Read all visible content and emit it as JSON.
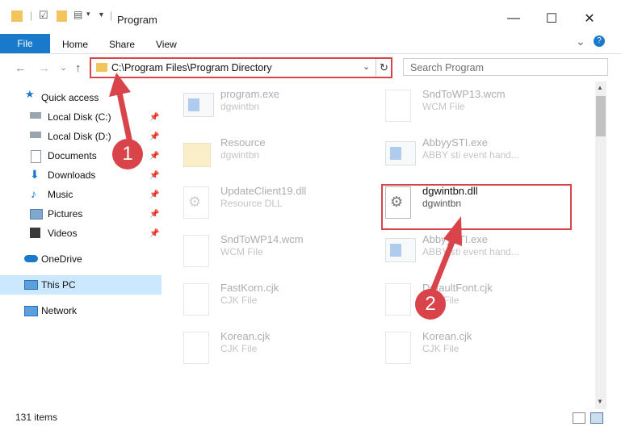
{
  "window": {
    "title": "Program",
    "minimize_glyph": "—",
    "maximize_glyph": "☐",
    "close_glyph": "✕"
  },
  "ribbon": {
    "tabs": [
      "File",
      "Home",
      "Share",
      "View"
    ],
    "collapse_glyph": "⌄",
    "help_glyph": "?"
  },
  "address": {
    "path": "C:\\Program Files\\Program Directory",
    "dropdown_glyph": "⌄",
    "refresh_glyph": "↻"
  },
  "search": {
    "placeholder": "Search Program"
  },
  "nav": {
    "back_glyph": "←",
    "forward_glyph": "→",
    "history_glyph": "⌄",
    "up_glyph": "↑",
    "items": [
      {
        "label": "Quick access",
        "icon": "star-icon",
        "pinned": false
      },
      {
        "label": "Local Disk (C:)",
        "icon": "drive-icon",
        "pinned": true
      },
      {
        "label": "Local Disk (D:)",
        "icon": "drive-icon",
        "pinned": true
      },
      {
        "label": "Documents",
        "icon": "documents-icon",
        "pinned": true
      },
      {
        "label": "Downloads",
        "icon": "download-icon",
        "pinned": true
      },
      {
        "label": "Music",
        "icon": "music-icon",
        "pinned": true
      },
      {
        "label": "Pictures",
        "icon": "pictures-icon",
        "pinned": true
      },
      {
        "label": "Videos",
        "icon": "videos-icon",
        "pinned": true
      },
      {
        "label": "OneDrive",
        "icon": "cloud-icon",
        "pinned": false
      },
      {
        "label": "This PC",
        "icon": "computer-icon",
        "pinned": false,
        "selected": true
      },
      {
        "label": "Network",
        "icon": "network-icon",
        "pinned": false
      }
    ]
  },
  "files": [
    {
      "name": "program.exe",
      "sub": "dgwintbn",
      "icon": "exe-icon"
    },
    {
      "name": "SndToWP13.wcm",
      "sub": "WCM File",
      "icon": "file-icon"
    },
    {
      "name": "Resource",
      "sub": "dgwintbn",
      "icon": "folder-icon"
    },
    {
      "name": "AbbyySTI.exe",
      "sub": "ABBY sti event hand...",
      "icon": "exe-icon"
    },
    {
      "name": "UpdateClient19.dll",
      "sub": "Resource DLL",
      "icon": "dll-icon"
    },
    {
      "name": "dgwintbn.dll",
      "sub": "dgwintbn",
      "icon": "dll-icon",
      "selected": true
    },
    {
      "name": "SndToWP14.wcm",
      "sub": "WCM File",
      "icon": "file-icon"
    },
    {
      "name": "AbbyySTI.exe",
      "sub": "ABBY sti event hand...",
      "icon": "exe-icon"
    },
    {
      "name": "FastKorn.cjk",
      "sub": "CJK File",
      "icon": "file-icon"
    },
    {
      "name": "DefaultFont.cjk",
      "sub": "CJK File",
      "icon": "file-icon"
    },
    {
      "name": "Korean.cjk",
      "sub": "CJK File",
      "icon": "file-icon"
    },
    {
      "name": "Korean.cjk",
      "sub": "CJK File",
      "icon": "file-icon"
    }
  ],
  "status": {
    "item_count": "131 items"
  },
  "annotations": {
    "step1": "1",
    "step2": "2"
  },
  "colors": {
    "accent": "#1979ca",
    "highlight": "#d9434a",
    "selection": "#cce8ff"
  }
}
